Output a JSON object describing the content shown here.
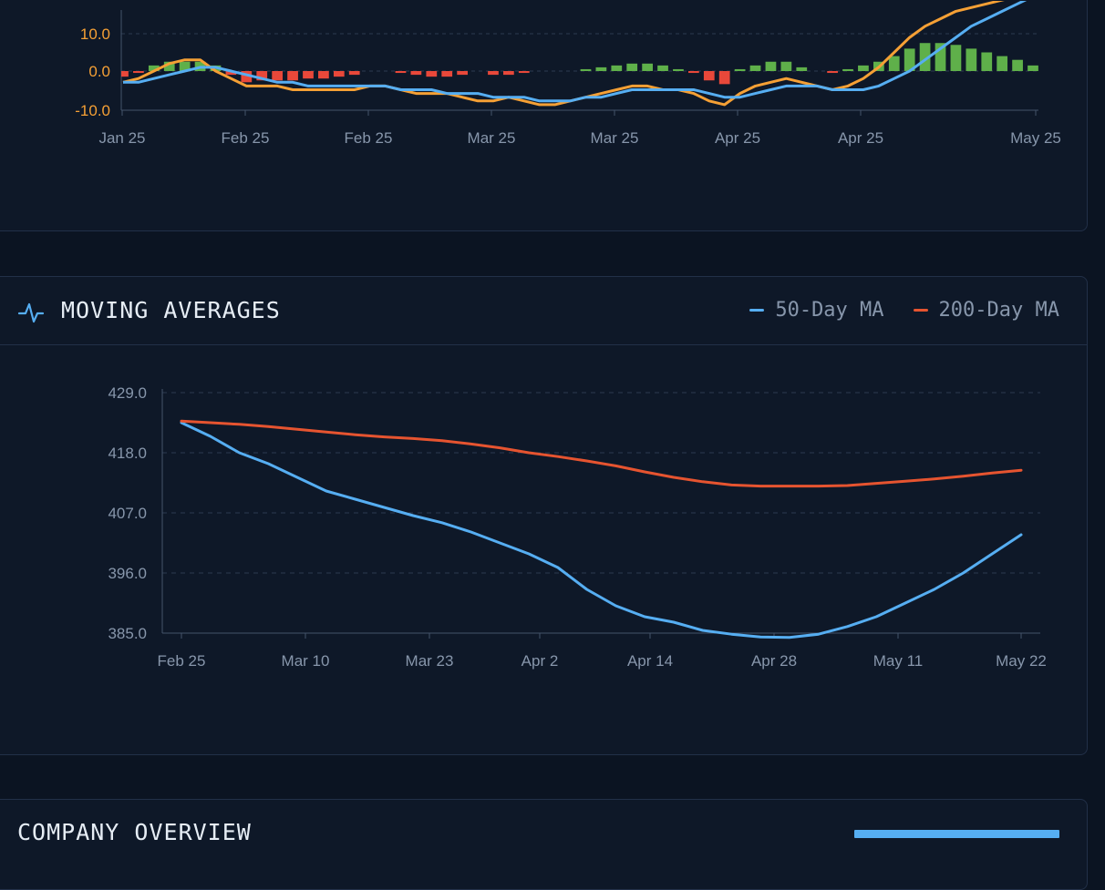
{
  "colors": {
    "macd": "#f5a035",
    "signal": "#56aef2",
    "hist_pos": "#5fb04a",
    "hist_neg": "#e8483a",
    "ma50": "#56aef2",
    "ma200": "#e65430",
    "grid": "#2c3a50",
    "axis": "#44536a",
    "tick_label_macd": "#f5a035",
    "tick_label": "#8796ab"
  },
  "macd_panel": {
    "icon": "none"
  },
  "ma_panel": {
    "title": "MOVING AVERAGES",
    "icon": "pulse-icon",
    "legend": [
      {
        "label": "50-Day MA",
        "color": "#56aef2"
      },
      {
        "label": "200-Day MA",
        "color": "#e65430"
      }
    ]
  },
  "company_overview": {
    "title": "COMPANY OVERVIEW"
  },
  "chart_data": [
    {
      "type": "line",
      "title": "",
      "x_tick_labels": [
        "Jan 25",
        "Feb 25",
        "Feb 25",
        "Mar 25",
        "Mar 25",
        "Apr 25",
        "Apr 25",
        "May 25"
      ],
      "y_ticks": [
        "10.0",
        "0.0",
        "-10.0"
      ],
      "ylim": [
        -10,
        10
      ],
      "grid": true,
      "series": [
        {
          "kind": "line",
          "color": "#f5a035",
          "values": [
            -3,
            -2,
            0,
            2,
            3,
            3,
            0,
            -2,
            -4,
            -4,
            -4,
            -5,
            -5,
            -5,
            -5,
            -5,
            -4,
            -4,
            -5,
            -6,
            -6,
            -6,
            -7,
            -8,
            -8,
            -7,
            -8,
            -9,
            -9,
            -8,
            -7,
            -6,
            -5,
            -4,
            -4,
            -5,
            -5,
            -6,
            -8,
            -9,
            -6,
            -4,
            -3,
            -2,
            -3,
            -4,
            -5,
            -4,
            -2,
            1,
            5,
            9,
            12,
            14,
            16,
            17,
            18,
            19,
            20,
            21
          ]
        },
        {
          "kind": "line",
          "color": "#56aef2",
          "values": [
            -3,
            -3,
            -2,
            -1,
            0,
            1,
            1,
            0,
            -1,
            -2,
            -3,
            -3,
            -4,
            -4,
            -4,
            -4,
            -4,
            -4,
            -5,
            -5,
            -5,
            -6,
            -6,
            -6,
            -7,
            -7,
            -7,
            -8,
            -8,
            -8,
            -7,
            -7,
            -6,
            -5,
            -5,
            -5,
            -5,
            -5,
            -6,
            -7,
            -7,
            -6,
            -5,
            -4,
            -4,
            -4,
            -5,
            -5,
            -5,
            -4,
            -2,
            0,
            3,
            6,
            9,
            12,
            14,
            16,
            18,
            20
          ]
        },
        {
          "kind": "bar",
          "name": "histogram",
          "values": [
            -1.5,
            -0.5,
            1.5,
            2.5,
            2.5,
            2.5,
            1.5,
            -1,
            -3,
            -2.5,
            -2.5,
            -2.5,
            -2,
            -2,
            -1.5,
            -1,
            0,
            0,
            -0.5,
            -1,
            -1.5,
            -1.5,
            -1,
            0,
            -1,
            -1,
            -0.5,
            0,
            0,
            0,
            0.5,
            1,
            1.5,
            2,
            2,
            1.5,
            0.5,
            -0.5,
            -2.5,
            -3.5,
            0.5,
            1.5,
            2.5,
            2.5,
            1,
            0,
            -0.5,
            0.5,
            1.5,
            2.5,
            4,
            6,
            7.5,
            7.5,
            7,
            6,
            5,
            4,
            3,
            1.5
          ]
        }
      ]
    },
    {
      "type": "line",
      "title": "MOVING AVERAGES",
      "x_tick_labels": [
        "Feb 25",
        "Mar 10",
        "Mar 23",
        "Apr 2",
        "Apr 14",
        "Apr 28",
        "May 11",
        "May 22"
      ],
      "y_ticks": [
        429.0,
        418.0,
        407.0,
        396.0,
        385.0
      ],
      "ylim": [
        385,
        429
      ],
      "grid": true,
      "series": [
        {
          "name": "50-Day MA",
          "color": "#56aef2",
          "values": [
            423.5,
            421.0,
            418.0,
            416.0,
            413.5,
            411.0,
            409.5,
            408.0,
            406.5,
            405.2,
            403.5,
            401.5,
            399.5,
            397.0,
            393.0,
            390.0,
            388.0,
            387.0,
            385.5,
            384.8,
            384.3,
            384.2,
            384.8,
            386.2,
            388.0,
            390.5,
            393.0,
            396.0,
            399.5,
            403.0
          ]
        },
        {
          "name": "200-Day MA",
          "color": "#e65430",
          "values": [
            423.8,
            423.5,
            423.2,
            422.8,
            422.3,
            421.8,
            421.3,
            420.9,
            420.6,
            420.2,
            419.6,
            418.9,
            418.0,
            417.3,
            416.5,
            415.6,
            414.5,
            413.5,
            412.7,
            412.1,
            411.9,
            411.9,
            411.9,
            412.0,
            412.4,
            412.8,
            413.2,
            413.7,
            414.3,
            414.8
          ]
        }
      ]
    }
  ]
}
